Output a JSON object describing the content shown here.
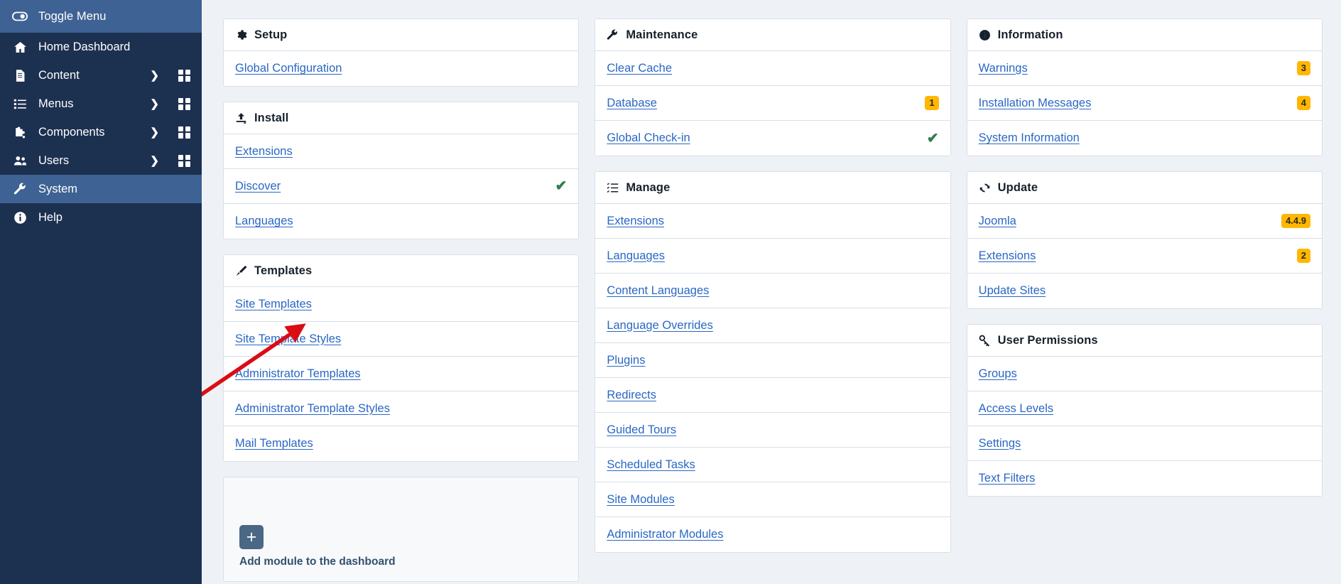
{
  "sidebar": {
    "toggle": {
      "label": "Toggle Menu",
      "icon": "toggle-icon"
    },
    "items": [
      {
        "label": "Home Dashboard",
        "icon": "home-icon",
        "active": false,
        "chevron": false,
        "grid": false
      },
      {
        "label": "Content",
        "icon": "document-icon",
        "active": false,
        "chevron": true,
        "grid": true
      },
      {
        "label": "Menus",
        "icon": "list-icon",
        "active": false,
        "chevron": true,
        "grid": true
      },
      {
        "label": "Components",
        "icon": "puzzle-icon",
        "active": false,
        "chevron": true,
        "grid": true
      },
      {
        "label": "Users",
        "icon": "users-icon",
        "active": false,
        "chevron": true,
        "grid": true
      },
      {
        "label": "System",
        "icon": "wrench-icon",
        "active": true,
        "chevron": false,
        "grid": false
      },
      {
        "label": "Help",
        "icon": "info-icon",
        "active": false,
        "chevron": false,
        "grid": false
      }
    ]
  },
  "columns": [
    {
      "cards": [
        {
          "title": "Setup",
          "icon": "gear-icon",
          "rows": [
            {
              "label": "Global Configuration"
            }
          ]
        },
        {
          "title": "Install",
          "icon": "upload-icon",
          "rows": [
            {
              "label": "Extensions"
            },
            {
              "label": "Discover",
              "check": true
            },
            {
              "label": "Languages"
            }
          ]
        },
        {
          "title": "Templates",
          "icon": "brush-icon",
          "rows": [
            {
              "label": "Site Templates"
            },
            {
              "label": "Site Template Styles"
            },
            {
              "label": "Administrator Templates"
            },
            {
              "label": "Administrator Template Styles"
            },
            {
              "label": "Mail Templates"
            }
          ]
        }
      ],
      "add_module": {
        "label": "Add module to the dashboard",
        "icon": "plus-icon"
      }
    },
    {
      "cards": [
        {
          "title": "Maintenance",
          "icon": "wrench-icon",
          "rows": [
            {
              "label": "Clear Cache"
            },
            {
              "label": "Database",
              "badge": "1"
            },
            {
              "label": "Global Check-in",
              "check": true
            }
          ]
        },
        {
          "title": "Manage",
          "icon": "tasklist-icon",
          "rows": [
            {
              "label": "Extensions"
            },
            {
              "label": "Languages"
            },
            {
              "label": "Content Languages"
            },
            {
              "label": "Language Overrides"
            },
            {
              "label": "Plugins"
            },
            {
              "label": "Redirects"
            },
            {
              "label": "Guided Tours"
            },
            {
              "label": "Scheduled Tasks"
            },
            {
              "label": "Site Modules"
            },
            {
              "label": "Administrator Modules"
            }
          ]
        }
      ]
    },
    {
      "cards": [
        {
          "title": "Information",
          "icon": "info-icon",
          "rows": [
            {
              "label": "Warnings",
              "badge": "3"
            },
            {
              "label": "Installation Messages",
              "badge": "4"
            },
            {
              "label": "System Information"
            }
          ]
        },
        {
          "title": "Update",
          "icon": "refresh-icon",
          "rows": [
            {
              "label": "Joomla",
              "badge": "4.4.9"
            },
            {
              "label": "Extensions",
              "badge": "2"
            },
            {
              "label": "Update Sites"
            }
          ]
        },
        {
          "title": "User Permissions",
          "icon": "key-icon",
          "rows": [
            {
              "label": "Groups"
            },
            {
              "label": "Access Levels"
            },
            {
              "label": "Settings"
            },
            {
              "label": "Text Filters"
            }
          ]
        }
      ]
    }
  ],
  "annotation": {
    "arrow_color": "#dc0c14",
    "points_to": "Site Template Styles"
  },
  "colors": {
    "sidebar_bg": "#1c3050",
    "sidebar_active": "#3e6294",
    "link": "#2a67c4",
    "badge": "#ffb703",
    "check": "#2e7d4f",
    "page_bg": "#eef2f6"
  }
}
